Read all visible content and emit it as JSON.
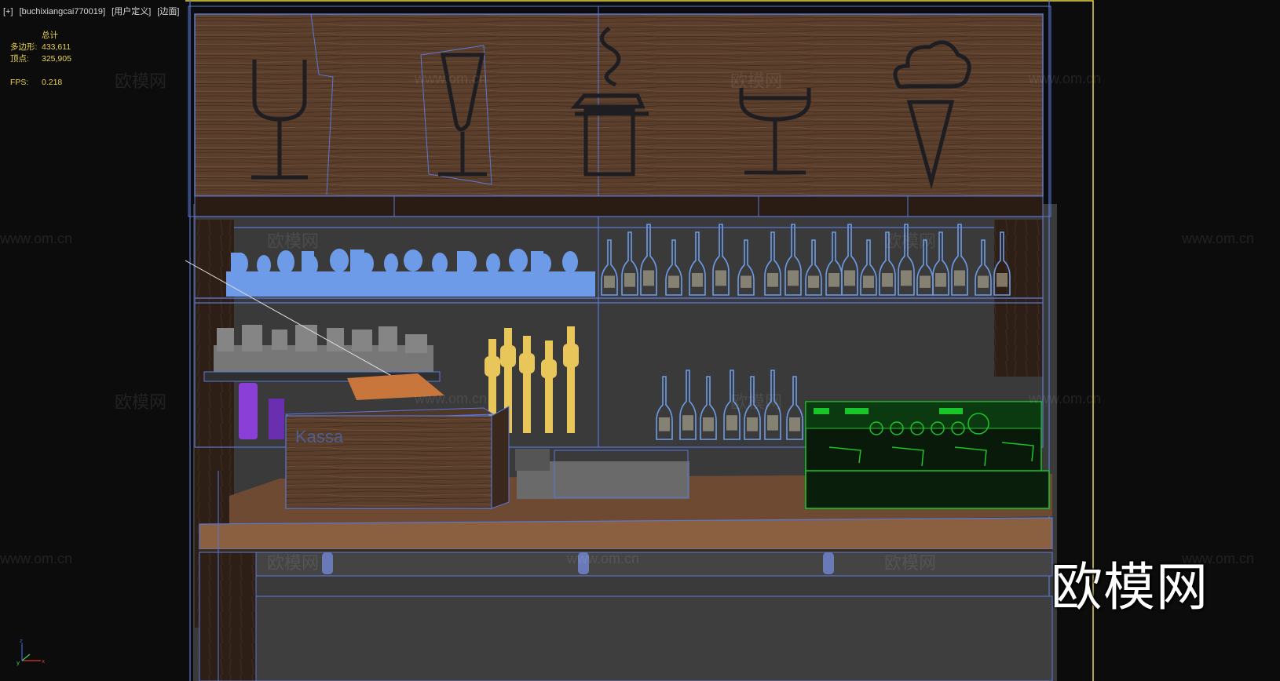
{
  "viewport": {
    "labels": [
      "[+]",
      "[buchixiangcai770019]",
      "[用户定义]",
      "[边面]"
    ]
  },
  "stats": {
    "title": "总计",
    "polygons_label": "多边形:",
    "polygons_value": "433,611",
    "vertices_label": "顶点:",
    "vertices_value": "325,905",
    "fps_label": "FPS:",
    "fps_value": "0.218"
  },
  "scene": {
    "register_label": "Kassa"
  },
  "watermark": {
    "small_text": "欧模网",
    "url_text": "www.om.cn",
    "big_text": "欧模网"
  },
  "colors": {
    "background": "#0c0c0c",
    "wireframe": "#5a78d8",
    "wood": "#5a3e2b",
    "bottles": "#6d9be8",
    "taps": "#e8c65a",
    "coffee_machine": "#19c52a",
    "stats_text": "#e8d24a",
    "viewport_border": "#e8d84a"
  }
}
